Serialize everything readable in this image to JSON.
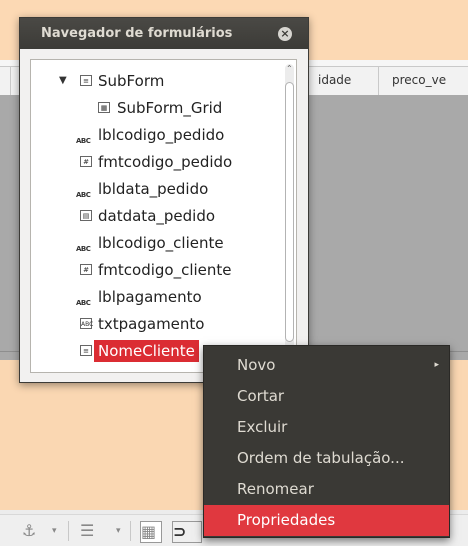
{
  "background": {
    "column_headers": [
      "idade",
      "preco_ve"
    ]
  },
  "navigator": {
    "title": "Navegador de formulários",
    "tree": [
      {
        "label": "SubForm",
        "icon": "form-icon",
        "indent": 0,
        "expander": "▼"
      },
      {
        "label": "SubForm_Grid",
        "icon": "grid-icon",
        "indent": 1
      },
      {
        "label": "lblcodigo_pedido",
        "icon": "label-icon",
        "indent": 0
      },
      {
        "label": "fmtcodigo_pedido",
        "icon": "formatted-field-icon",
        "indent": 0
      },
      {
        "label": "lbldata_pedido",
        "icon": "label-icon",
        "indent": 0
      },
      {
        "label": "datdata_pedido",
        "icon": "date-field-icon",
        "indent": 0
      },
      {
        "label": "lblcodigo_cliente",
        "icon": "label-icon",
        "indent": 0
      },
      {
        "label": "fmtcodigo_cliente",
        "icon": "formatted-field-icon",
        "indent": 0
      },
      {
        "label": "lblpagamento",
        "icon": "label-icon",
        "indent": 0
      },
      {
        "label": "txtpagamento",
        "icon": "text-field-icon",
        "indent": 0
      },
      {
        "label": "NomeCliente",
        "icon": "form-icon",
        "indent": 0,
        "selected": true
      }
    ]
  },
  "context_menu": {
    "items": [
      {
        "label": "Novo",
        "has_submenu": true
      },
      {
        "label": "Cortar"
      },
      {
        "label": "Excluir"
      },
      {
        "label": "Ordem de tabulação..."
      },
      {
        "label": "Renomear"
      },
      {
        "label": "Propriedades",
        "highlighted": true
      }
    ],
    "highlight_color": "#e0383f"
  },
  "colors": {
    "selection": "#db2c33",
    "titlebar": "#3c3b37",
    "document": "#fcd9b4"
  }
}
